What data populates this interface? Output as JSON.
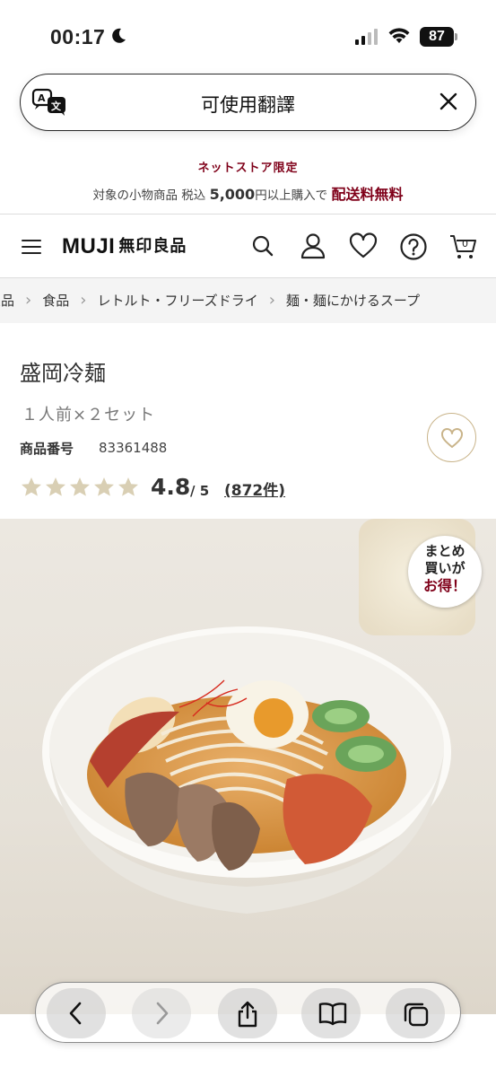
{
  "status": {
    "time": "00:17",
    "battery": "87"
  },
  "translate": {
    "label": "可使用翻譯",
    "icon": "translate-icon"
  },
  "promo": {
    "title": "ネットストア限定",
    "line_prefix": "対象の小物商品 税込",
    "amount": "5,000",
    "line_middle": "円以上購入で",
    "free_shipping": "配送料無料"
  },
  "header": {
    "logo_text": "MUJI",
    "logo_jp": "無印良品",
    "icons": [
      "menu-icon",
      "search-icon",
      "account-icon",
      "favorites-icon",
      "help-icon",
      "cart-icon"
    ],
    "cart_count": "0"
  },
  "breadcrumb": [
    "良品",
    "食品",
    "レトルト・フリーズドライ",
    "麺・麺にかけるスープ"
  ],
  "product": {
    "title": "盛岡冷麺",
    "subtitle": "１人前×２セット",
    "code_label": "商品番号",
    "code": "83361488",
    "rating": "4.8",
    "rating_max": "/ 5",
    "reviews": "(872件)",
    "stars": 4.8
  },
  "badge": {
    "line1": "まとめ",
    "line2": "買いが",
    "line3": "お得！"
  },
  "colors": {
    "accent": "#7f0019",
    "star": "#d9cfb4",
    "fav_border": "#c9b48a"
  },
  "toolbar": {
    "buttons": [
      "back-icon",
      "forward-icon",
      "share-icon",
      "bookmarks-icon",
      "tabs-icon"
    ]
  }
}
